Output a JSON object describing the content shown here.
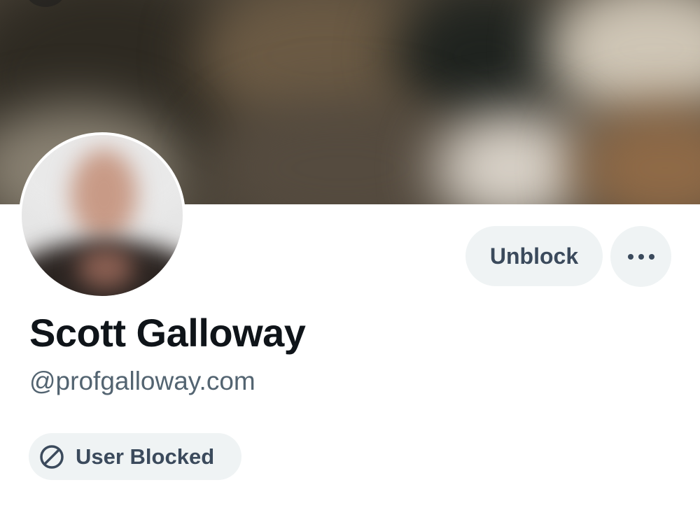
{
  "profile": {
    "display_name": "Scott Galloway",
    "handle": "@profgalloway.com"
  },
  "actions": {
    "unblock_label": "Unblock",
    "more_icon": "more-horizontal-icon"
  },
  "status": {
    "blocked_label": "User Blocked",
    "blocked_icon": "blocked-icon"
  },
  "colors": {
    "background": "#ffffff",
    "button_bg": "#eff3f4",
    "button_text": "#3b4a5c",
    "name_text": "#0f1419",
    "handle_text": "#536471"
  }
}
